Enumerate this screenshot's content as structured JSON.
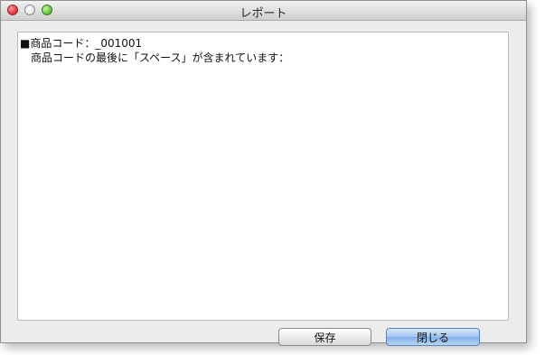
{
  "window": {
    "title": "レポート"
  },
  "report": {
    "lines": [
      "■商品コード：_001001",
      "商品コードの最後に「スペース」が含まれています："
    ]
  },
  "buttons": {
    "save_label": "保存",
    "close_label": "閉じる"
  },
  "colors": {
    "window_bg": "#ececec",
    "panel_bg": "#ffffff",
    "default_button": "#9ec3ef"
  }
}
